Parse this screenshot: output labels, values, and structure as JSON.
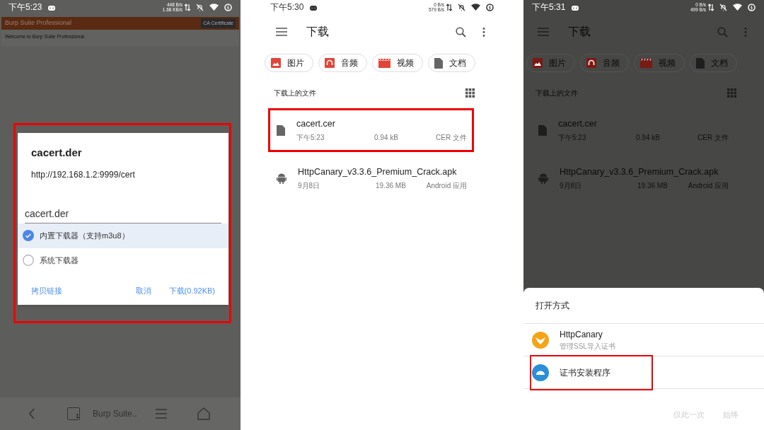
{
  "panels": [
    {
      "kind": "browser",
      "status_bar": {
        "time": "下午5:23",
        "up_speed": "448 B/s",
        "down_speed": "1.68 KB/s"
      },
      "page": {
        "title": "Burp Suite Professional",
        "button": "CA Certificate",
        "text": "Welcome to Burp Suite Professional."
      },
      "dialog": {
        "highlighted": true,
        "title": "cacert.der",
        "url": "http://192.168.1.2:9999/cert",
        "filename": "cacert.der",
        "options": [
          {
            "label": "内置下载器（支持m3u8）",
            "selected": true
          },
          {
            "label": "系统下载器",
            "selected": false
          }
        ],
        "actions": [
          "拷贝链接",
          "取消",
          "下载(0.92KB)"
        ]
      },
      "bottom_bar": {
        "tab_count": "1",
        "tab_title": "Burp Suite.."
      }
    },
    {
      "kind": "files",
      "status_bar": {
        "time": "下午5:30",
        "up_speed": "0 B/s",
        "down_speed": "579 B/s"
      },
      "title": "下载",
      "chips": [
        {
          "label": "图片",
          "kind": "image"
        },
        {
          "label": "音频",
          "kind": "audio"
        },
        {
          "label": "视频",
          "kind": "video"
        },
        {
          "label": "文档",
          "kind": "document"
        }
      ],
      "section": "下载上的文件",
      "files": [
        {
          "name": "cacert.cer",
          "date": "下午5:23",
          "size": "0.94 kB",
          "type": "CER 文件",
          "kind": "document",
          "highlighted": true
        },
        {
          "name": "HttpCanary_v3.3.6_Premium_Crack.apk",
          "date": "9月8日",
          "size": "19.36 MB",
          "type": "Android 应用",
          "kind": "android",
          "highlighted": false
        }
      ]
    },
    {
      "kind": "files",
      "status_bar": {
        "time": "下午5:31",
        "up_speed": "0 B/s",
        "down_speed": "499 B/s"
      },
      "title": "下载",
      "chips": [
        {
          "label": "图片",
          "kind": "image"
        },
        {
          "label": "音频",
          "kind": "audio"
        },
        {
          "label": "视频",
          "kind": "video"
        },
        {
          "label": "文档",
          "kind": "document"
        }
      ],
      "section": "下载上的文件",
      "files": [
        {
          "name": "cacert.cer",
          "date": "下午5:23",
          "size": "0.94 kB",
          "type": "CER 文件",
          "kind": "document",
          "highlighted": false
        },
        {
          "name": "HttpCanary_v3.3.6_Premium_Crack.apk",
          "date": "9月8日",
          "size": "19.36 MB",
          "type": "Android 应用",
          "kind": "android",
          "highlighted": false
        }
      ],
      "sheet": {
        "title": "打开方式",
        "apps": [
          {
            "name": "HttpCanary",
            "subtitle": "管理SSL导入证书",
            "kind": "canary",
            "highlighted": false
          },
          {
            "name": "证书安装程序",
            "kind": "android",
            "highlighted": true
          }
        ],
        "actions": [
          "仅此一次",
          "始终"
        ]
      }
    }
  ]
}
